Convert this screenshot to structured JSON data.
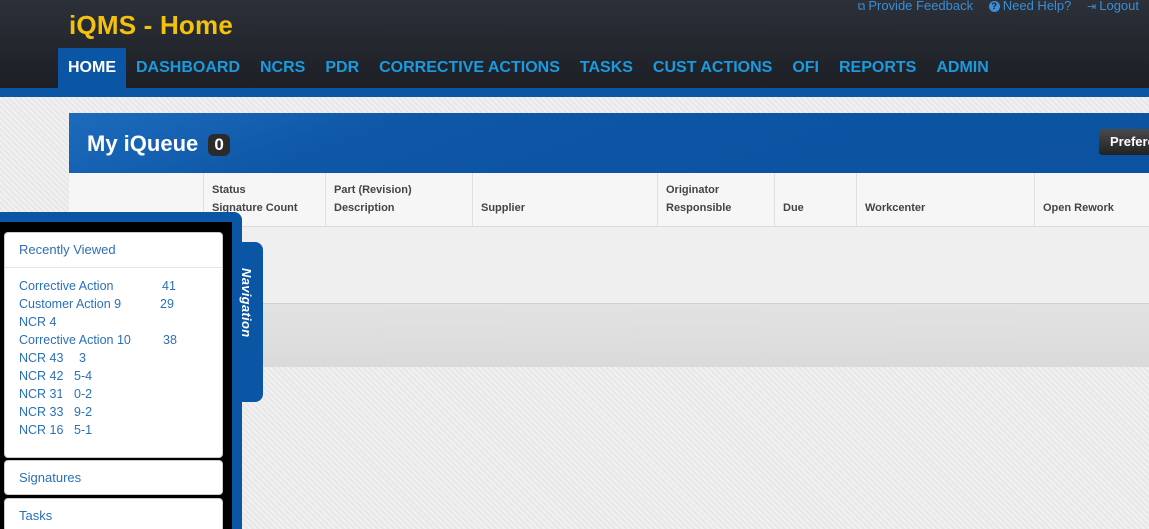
{
  "app": {
    "title": "iQMS - Home"
  },
  "top_links": [
    {
      "icon": "external-link-icon",
      "label": "Provide Feedback"
    },
    {
      "icon": "question-circle-icon",
      "label": "Need Help?"
    },
    {
      "icon": "logout-icon",
      "label": "Logout"
    }
  ],
  "nav": [
    "HOME",
    "DASHBOARD",
    "NCRS",
    "PDR",
    "CORRECTIVE ACTIONS",
    "TASKS",
    "CUST ACTIONS",
    "OFI",
    "REPORTS",
    "ADMIN"
  ],
  "active_nav": "HOME",
  "queue": {
    "title": "My iQueue",
    "count": "0",
    "preferences_label": "Prefere",
    "columns": [
      {
        "line1": "",
        "line2": ""
      },
      {
        "line1": "Status",
        "line2": "Signature Count"
      },
      {
        "line1": "Part (Revision)",
        "line2": "Description"
      },
      {
        "line1": "",
        "line2": "Supplier"
      },
      {
        "line1": "Originator",
        "line2": "Responsible"
      },
      {
        "line1": "",
        "line2": "Due"
      },
      {
        "line1": "",
        "line2": "Workcenter"
      },
      {
        "line1": "",
        "line2": "Open Rework"
      }
    ]
  },
  "navigation": {
    "tab_label": "Navigation",
    "recently_viewed": {
      "title": "Recently Viewed",
      "items": [
        {
          "name": "Corrective Action",
          "id": "41"
        },
        {
          "name": "Customer Action 9",
          "id": "29"
        },
        {
          "name": "NCR 4",
          "id": ""
        },
        {
          "name": "Corrective Action 10",
          "id": "38"
        },
        {
          "name": "NCR 43",
          "id": "3"
        },
        {
          "name": "NCR 42",
          "id": "5-4"
        },
        {
          "name": "NCR 31",
          "id": "0-2"
        },
        {
          "name": "NCR 33",
          "id": "9-2"
        },
        {
          "name": "NCR 16",
          "id": "5-1"
        }
      ]
    },
    "signatures_label": "Signatures",
    "tasks_label": "Tasks"
  },
  "colors": {
    "brand_blue": "#0b55a5",
    "title_yellow": "#f4c20d",
    "nav_link": "#1a9ae0",
    "header_dark": "#22262d"
  }
}
